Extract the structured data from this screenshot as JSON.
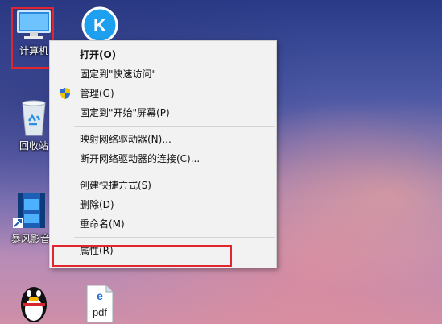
{
  "desktop": {
    "icons": [
      {
        "id": "computer",
        "label": "计算机"
      },
      {
        "id": "kugou",
        "label": ""
      },
      {
        "id": "recycle-bin",
        "label": "回收站"
      },
      {
        "id": "baofeng",
        "label": "暴风影音"
      },
      {
        "id": "qq",
        "label": ""
      },
      {
        "id": "pdf",
        "label": ""
      }
    ]
  },
  "context_menu": {
    "items": [
      {
        "label": "打开(O)",
        "bold": true
      },
      {
        "label": "固定到\"快速访问\""
      },
      {
        "label": "管理(G)",
        "icon": "shield-icon"
      },
      {
        "label": "固定到\"开始\"屏幕(P)"
      },
      {
        "label": "映射网络驱动器(N)..."
      },
      {
        "label": "断开网络驱动器的连接(C)..."
      },
      {
        "label": "创建快捷方式(S)"
      },
      {
        "label": "删除(D)"
      },
      {
        "label": "重命名(M)"
      },
      {
        "label": "属性(R)"
      }
    ]
  },
  "pdf_icon_text": "pdf",
  "kugou_letter": "K",
  "colors": {
    "highlight": "#e0262f",
    "menu_bg": "#f2f2f2"
  }
}
